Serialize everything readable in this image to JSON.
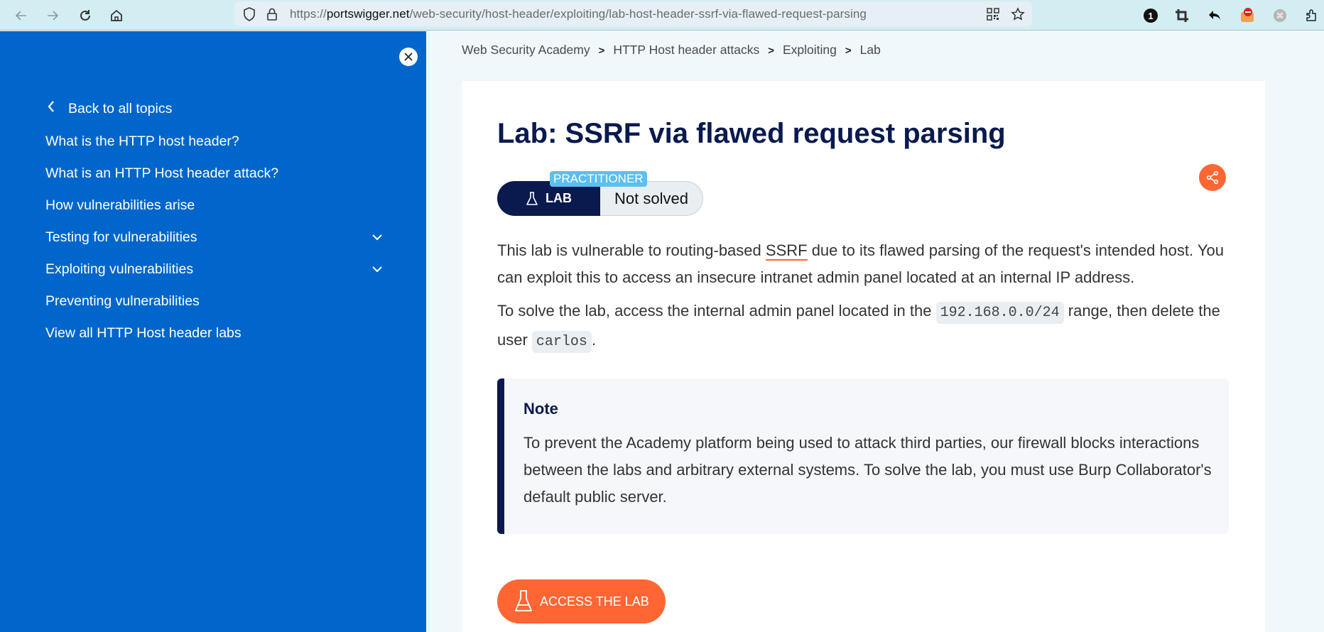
{
  "browser": {
    "url_prefix": "https://",
    "url_host": "portswigger.net",
    "url_path": "/web-security/host-header/exploiting/lab-host-header-ssrf-via-flawed-request-parsing",
    "extension_badge": "1"
  },
  "sidebar": {
    "back_label": "Back to all topics",
    "items": [
      {
        "label": "What is the HTTP host header?",
        "expandable": false
      },
      {
        "label": "What is an HTTP Host header attack?",
        "expandable": false
      },
      {
        "label": "How vulnerabilities arise",
        "expandable": false
      },
      {
        "label": "Testing for vulnerabilities",
        "expandable": true
      },
      {
        "label": "Exploiting vulnerabilities",
        "expandable": true
      },
      {
        "label": "Preventing vulnerabilities",
        "expandable": false
      },
      {
        "label": "View all HTTP Host header labs",
        "expandable": false
      }
    ]
  },
  "breadcrumb": [
    "Web Security Academy",
    "HTTP Host header attacks",
    "Exploiting",
    "Lab"
  ],
  "breadcrumb_separator": ">",
  "lab": {
    "title": "Lab: SSRF via flawed request parsing",
    "level": "PRACTITIONER",
    "badge_label": "LAB",
    "status": "Not solved",
    "description_1_a": "This lab is vulnerable to routing-based ",
    "description_1_link": "SSRF",
    "description_1_b": " due to its flawed parsing of the request's intended host. You can exploit this to access an insecure intranet admin panel located at an internal IP address.",
    "description_2_a": "To solve the lab, access the internal admin panel located in the ",
    "description_2_code1": "192.168.0.0/24",
    "description_2_b": " range, then delete the user ",
    "description_2_code2": "carlos",
    "description_2_c": ".",
    "note_title": "Note",
    "note_text": "To prevent the Academy platform being used to attack third parties, our firewall blocks interactions between the labs and arbitrary external systems. To solve the lab, you must use Burp Collaborator's default public server.",
    "access_button": "ACCESS THE LAB"
  },
  "colors": {
    "sidebar_bg": "#0066cc",
    "navy": "#0a1a4f",
    "accent_orange": "#ff6633",
    "level_blue": "#5ac0f0"
  }
}
